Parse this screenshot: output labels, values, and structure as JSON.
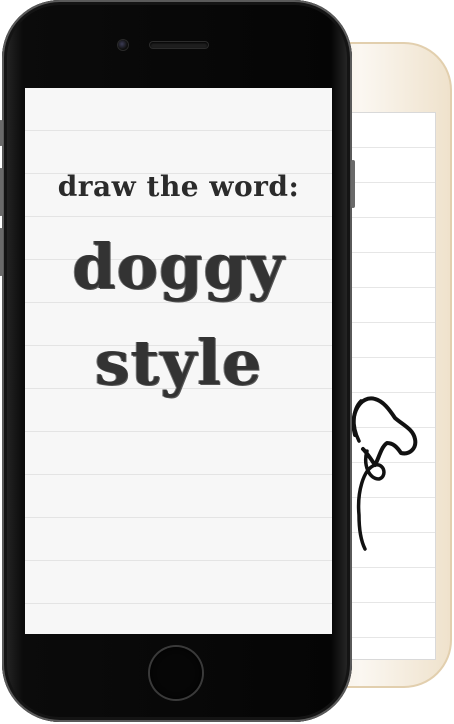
{
  "prompt": {
    "label": "draw the word:",
    "word_line1": "doggy",
    "word_line2": "style"
  },
  "colors": {
    "front_phone": "#0b0b0b",
    "back_phone": "#f4ebdc",
    "screen_background": "#f7f7f7",
    "text": "#2b2b2b"
  },
  "icons": {
    "home_button": "home-button",
    "camera": "front-camera-icon",
    "speaker": "earpiece-speaker-icon"
  }
}
